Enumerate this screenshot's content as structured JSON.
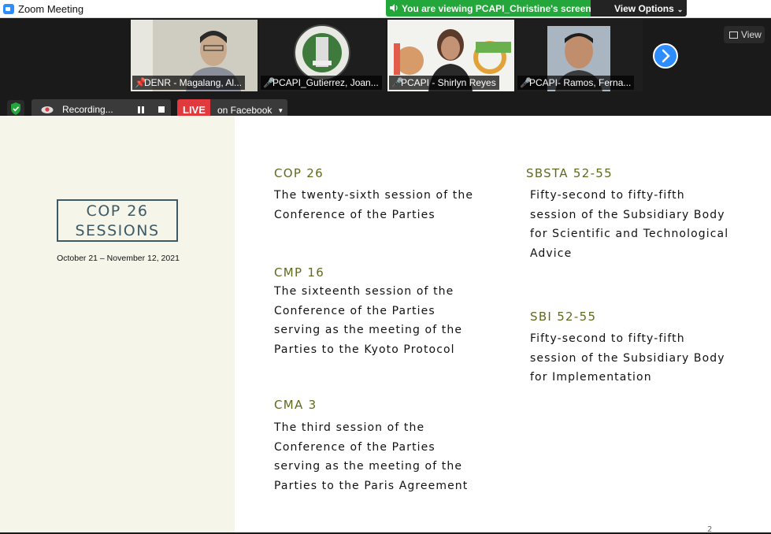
{
  "window": {
    "title": "Zoom Meeting"
  },
  "share_banner": {
    "text": "You are viewing PCAPI_Christine's screen",
    "view_options": "View Options"
  },
  "participants": [
    {
      "name": "DENR - Magalang, Al...",
      "pinned": true,
      "muted": false
    },
    {
      "name": "PCAPI_Gutierrez, Joan...",
      "muted": true
    },
    {
      "name": "PCAPI - Shirlyn Reyes",
      "muted": true
    },
    {
      "name": "PCAPI- Ramos, Ferna...",
      "muted": true
    }
  ],
  "view_button": "View",
  "recording": {
    "label": "Recording..."
  },
  "live": {
    "badge": "LIVE",
    "target": "on Facebook"
  },
  "slide": {
    "title_line1": "COP 26",
    "title_line2": "SESSIONS",
    "date": "October 21 – November 12, 2021",
    "sections": [
      {
        "heading": "COP 26",
        "lines": [
          "The twenty-sixth session of the",
          "Conference of the Parties"
        ]
      },
      {
        "heading": "CMP 16",
        "lines": [
          "The sixteenth session of the",
          "Conference of the Parties",
          "serving as the meeting of the",
          "Parties to the Kyoto Protocol"
        ]
      },
      {
        "heading": "CMA 3",
        "lines": [
          "The third session of the",
          "Conference of the Parties",
          "serving as the meeting of the",
          "Parties to the Paris Agreement"
        ]
      },
      {
        "heading": "SBSTA 52-55",
        "lines": [
          "Fifty-second to fifty-fifth",
          "session of the Subsidiary Body",
          "for Scientific and Technological",
          "Advice"
        ]
      },
      {
        "heading": "SBI 52-55",
        "lines": [
          "Fifty-second to fifty-fifth",
          "session of the Subsidiary Body",
          "for Implementation"
        ]
      }
    ],
    "page_number": "2"
  }
}
